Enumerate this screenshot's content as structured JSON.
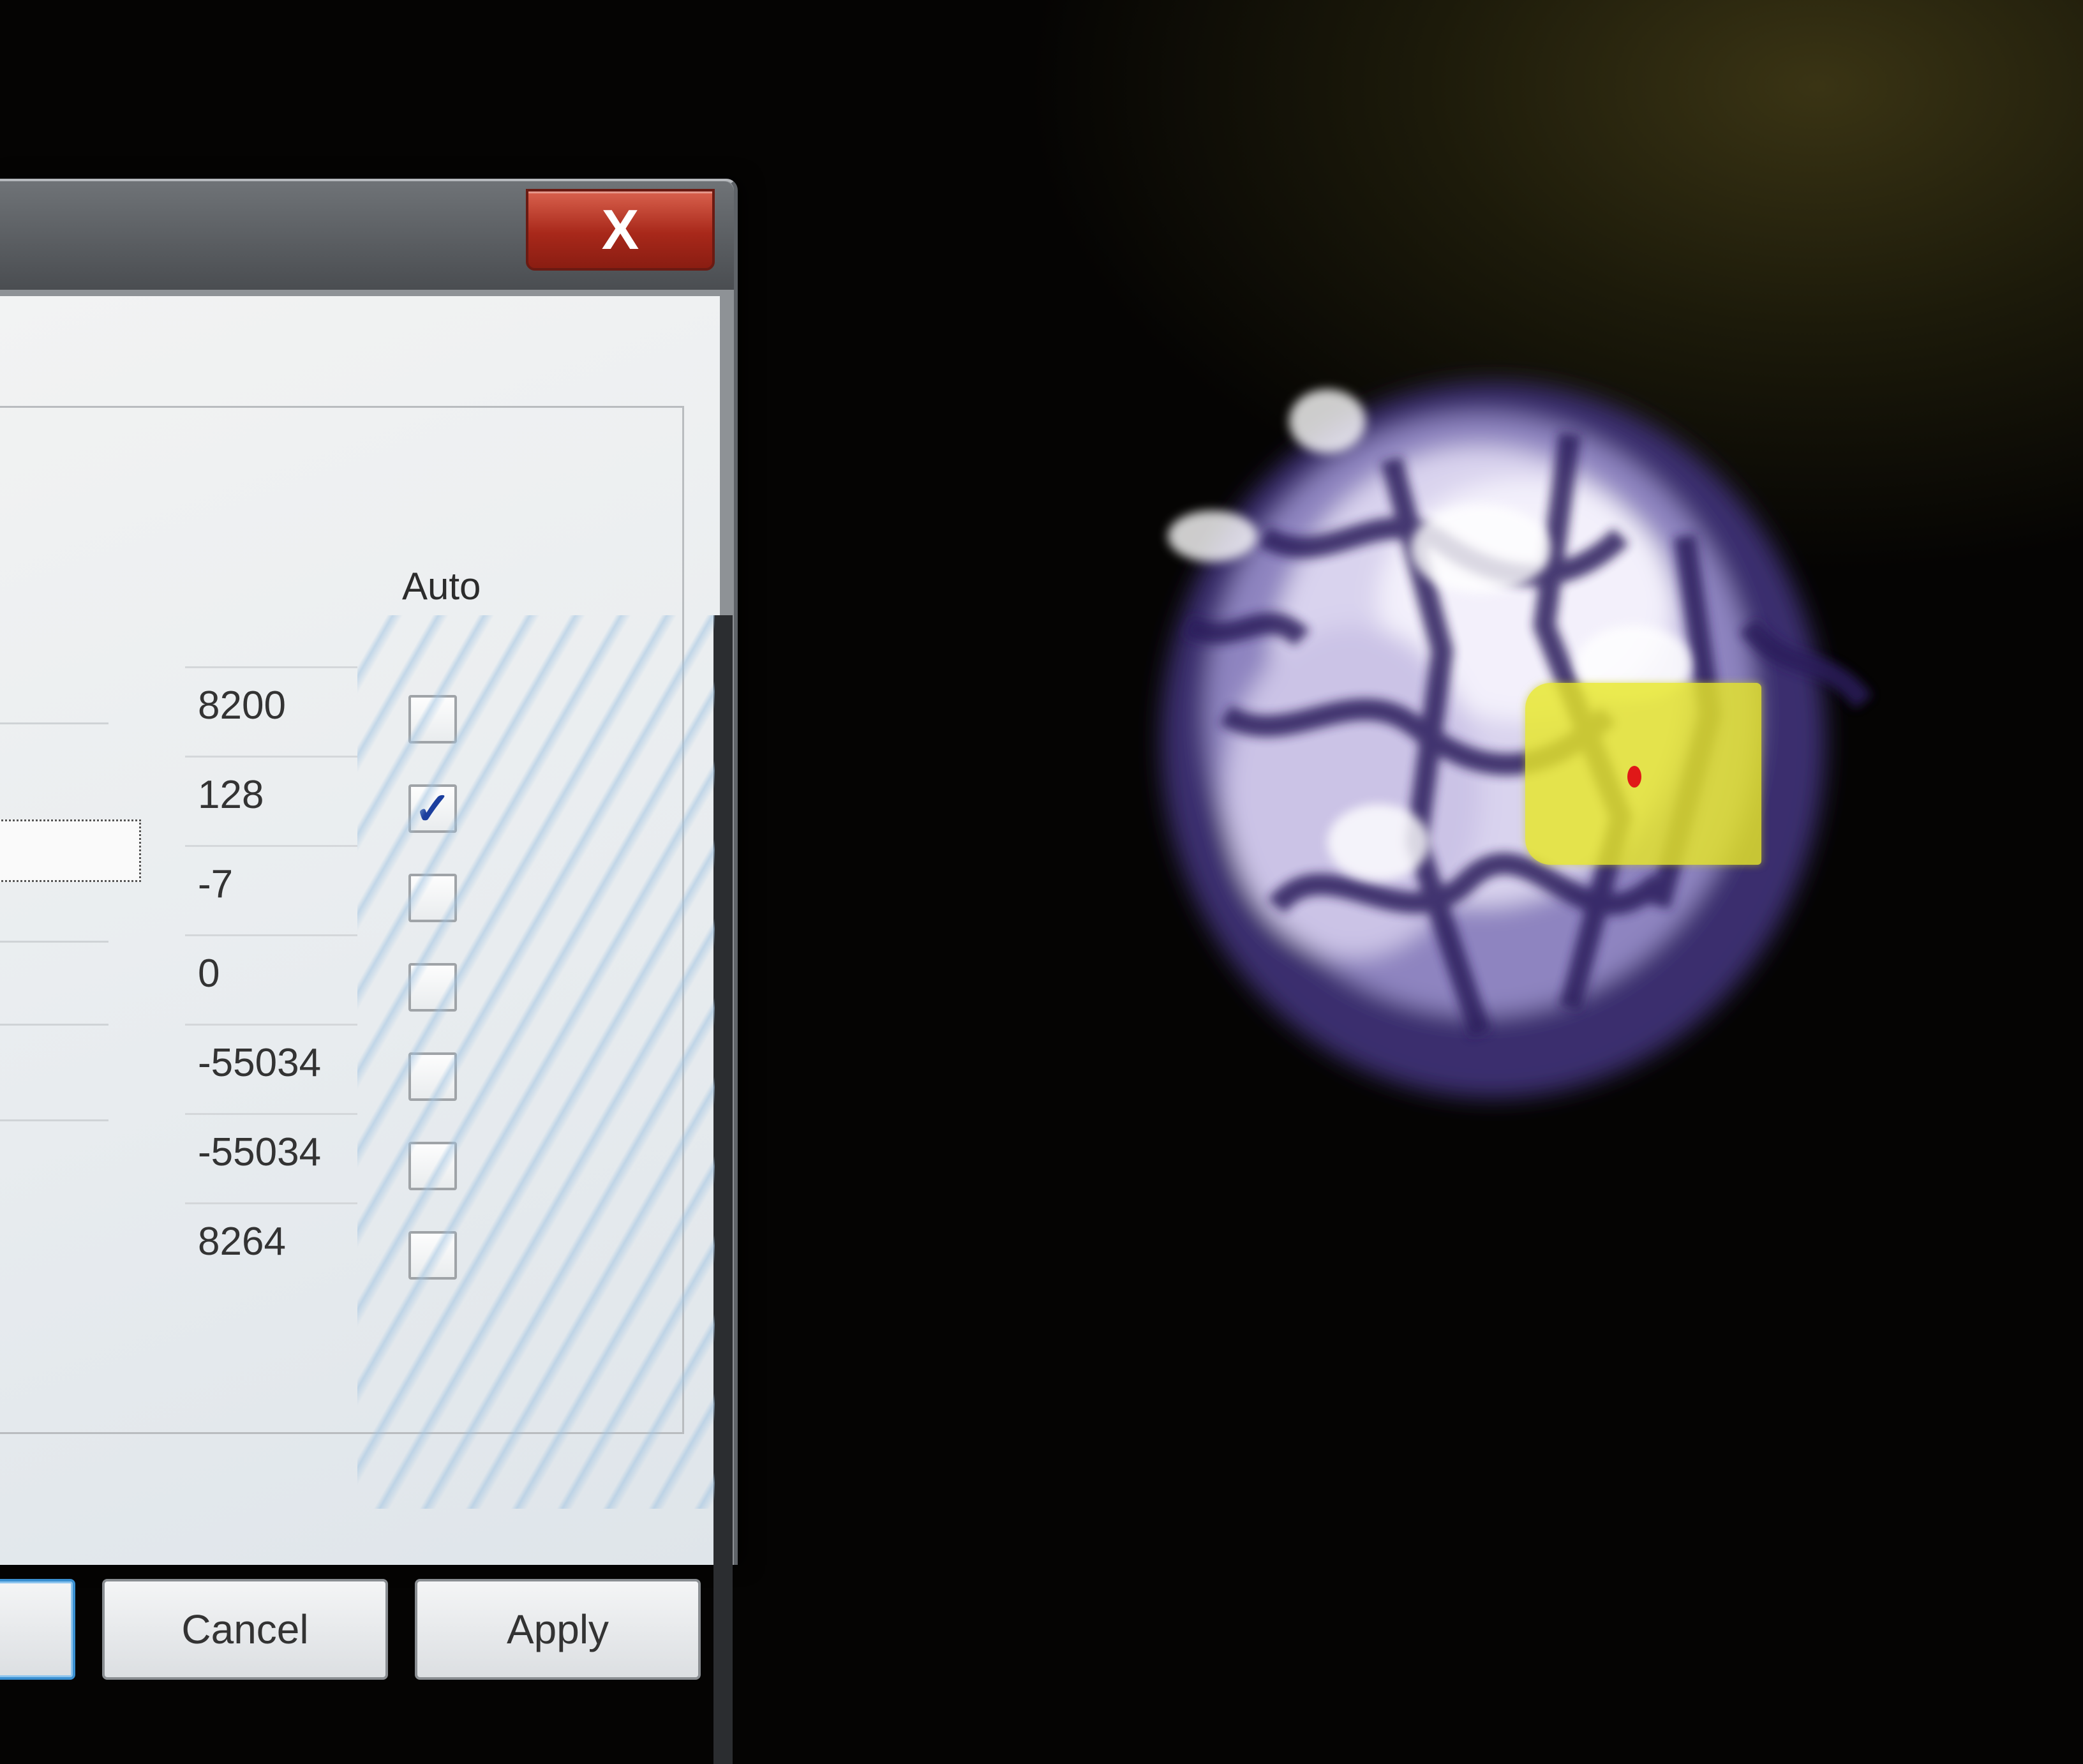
{
  "dialog": {
    "close_label": "X",
    "auto_header": "Auto",
    "rows": [
      {
        "value": "8200",
        "auto": false
      },
      {
        "value": "128",
        "auto": true
      },
      {
        "value": "-7",
        "auto": false
      },
      {
        "value": "0",
        "auto": false
      },
      {
        "value": "-55034",
        "auto": false
      },
      {
        "value": "-55034",
        "auto": false
      },
      {
        "value": "8264",
        "auto": false
      }
    ],
    "check_mark": "✓",
    "buttons": {
      "cancel": "Cancel",
      "apply": "Apply"
    }
  },
  "colors": {
    "selection": "#e6e628",
    "marker": "#e01818",
    "close_button": "#c0392b",
    "checkmark": "#1c3f9e"
  }
}
